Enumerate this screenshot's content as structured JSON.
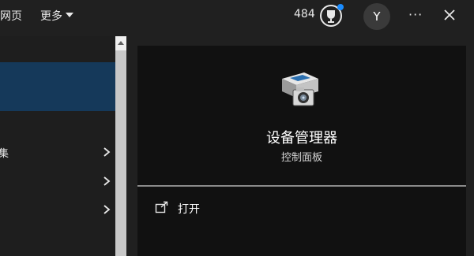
{
  "header": {
    "tab_web": "网页",
    "tab_more": "更多",
    "points": "484",
    "avatar_letter": "Y",
    "more_menu": "···"
  },
  "left_list": {
    "row_fragment": "集"
  },
  "detail": {
    "title": "设备管理器",
    "subtitle": "控制面板",
    "open_label": "打开",
    "icon": "device-manager-icon"
  },
  "colors": {
    "background": "#202020",
    "selected_row": "#15395a",
    "detail_background": "#111111",
    "notification_dot": "#1a8cff"
  }
}
